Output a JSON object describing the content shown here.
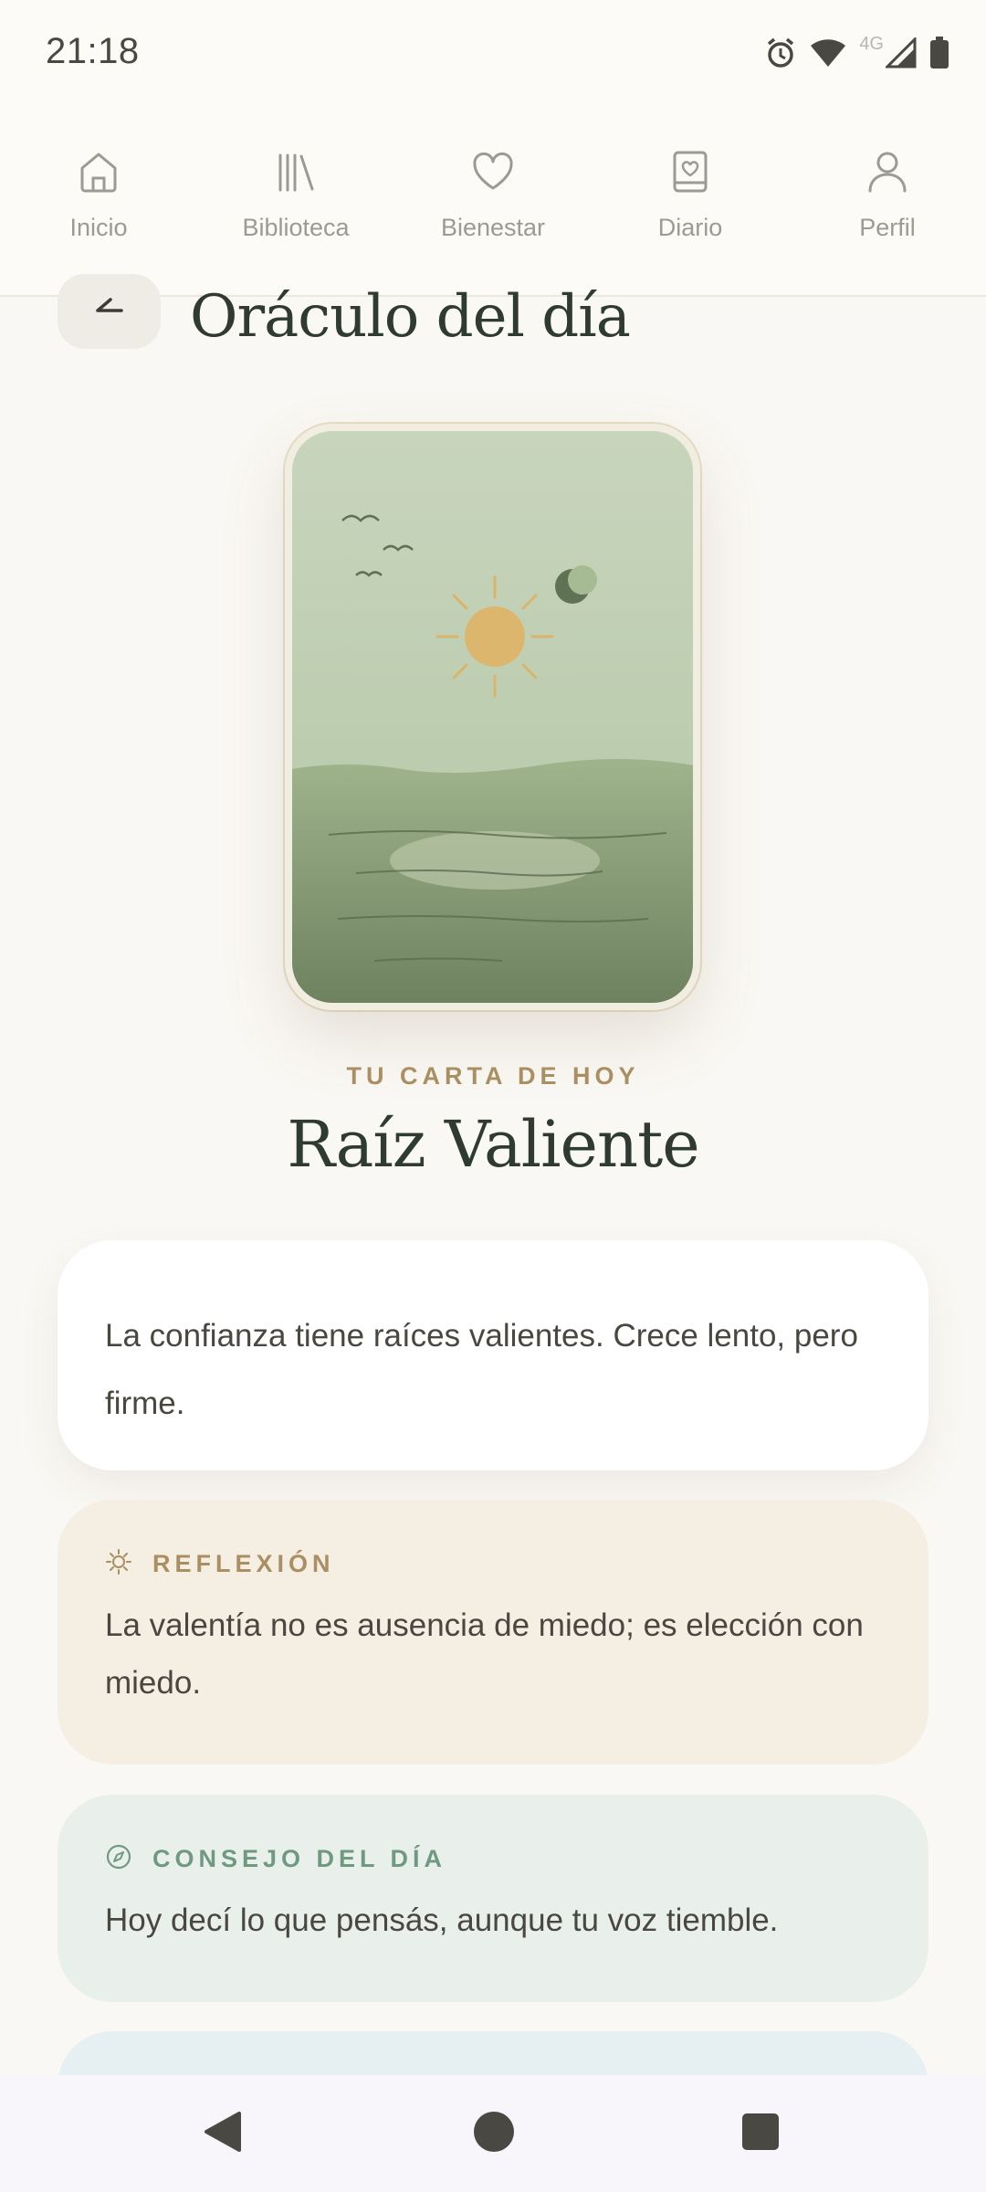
{
  "status_bar": {
    "time": "21:18",
    "network_label": "4G",
    "icons": [
      "alarm-icon",
      "wifi-icon",
      "signal-icon",
      "battery-icon"
    ]
  },
  "nav": {
    "items": [
      {
        "label": "Inicio",
        "icon": "home-icon"
      },
      {
        "label": "Biblioteca",
        "icon": "library-icon"
      },
      {
        "label": "Bienestar",
        "icon": "heart-icon"
      },
      {
        "label": "Diario",
        "icon": "journal-icon"
      },
      {
        "label": "Perfil",
        "icon": "profile-icon"
      }
    ]
  },
  "header": {
    "title": "Oráculo del día",
    "back_icon": "back-arrow-icon"
  },
  "card": {
    "eyebrow": "TU CARTA DE HOY",
    "name": "Raíz Valiente"
  },
  "message": {
    "text": "La confianza tiene raíces valientes. Crece lento, pero firme."
  },
  "reflexion": {
    "label": "REFLEXIÓN",
    "icon": "sun-icon",
    "text": "La valentía no es ausencia de miedo; es elección con miedo."
  },
  "consejo": {
    "label": "CONSEJO DEL DÍA",
    "icon": "compass-icon",
    "text": "Hoy decí lo que pensás, aunque tu voz tiemble."
  },
  "system_nav": {
    "buttons": [
      "back-triangle-icon",
      "home-circle-icon",
      "recents-square-icon"
    ]
  },
  "colors": {
    "background": "#faf8f4",
    "title": "#2f3a30",
    "accent_gold": "#a98f62",
    "accent_green": "#6f9a80",
    "reflexion_bg": "#f5eee2",
    "consejo_bg": "#e9f0ec"
  }
}
